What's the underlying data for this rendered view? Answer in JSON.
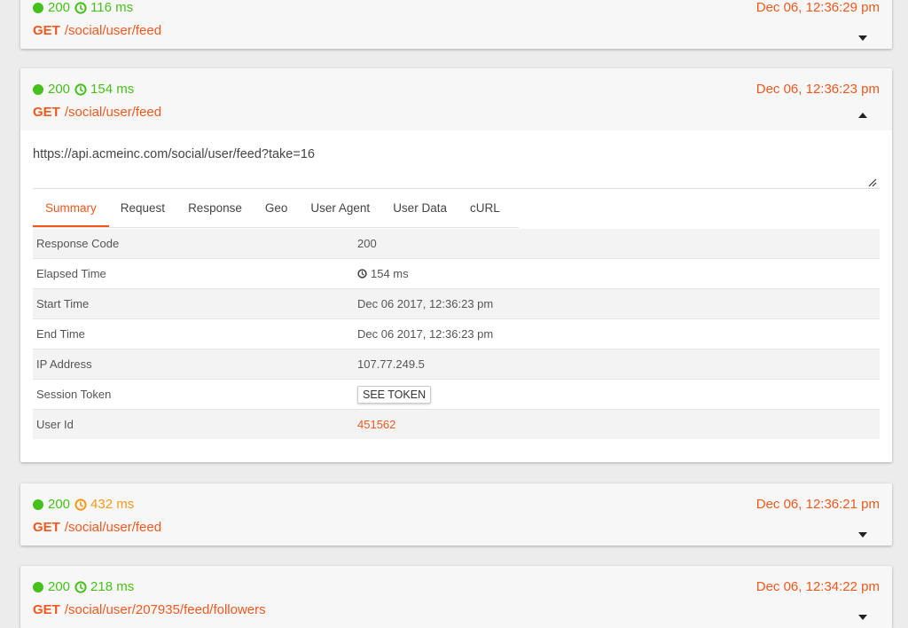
{
  "colors": {
    "success": "#46c01a",
    "warning": "#f39a1a",
    "accent": "#f0581e"
  },
  "requests": [
    {
      "status_code": "200",
      "duration": "116 ms",
      "duration_color": "green",
      "timestamp": "Dec 06, 12:36:29 pm",
      "method": "GET",
      "path": "/social/user/feed",
      "expanded": false
    },
    {
      "status_code": "200",
      "duration": "154 ms",
      "duration_color": "green",
      "timestamp": "Dec 06, 12:36:23 pm",
      "method": "GET",
      "path": "/social/user/feed",
      "expanded": true
    },
    {
      "status_code": "200",
      "duration": "432 ms",
      "duration_color": "orange",
      "timestamp": "Dec 06, 12:36:21 pm",
      "method": "GET",
      "path": "/social/user/feed",
      "expanded": false
    },
    {
      "status_code": "200",
      "duration": "218 ms",
      "duration_color": "green",
      "timestamp": "Dec 06, 12:34:22 pm",
      "method": "GET",
      "path": "/social/user/207935/feed/followers",
      "expanded": false
    }
  ],
  "detail": {
    "url": "https://api.acmeinc.com/social/user/feed?take=16",
    "tabs": [
      "Summary",
      "Request",
      "Response",
      "Geo",
      "User Agent",
      "User Data",
      "cURL"
    ],
    "active_tab": "Summary",
    "summary": {
      "response_code_label": "Response Code",
      "response_code": "200",
      "elapsed_label": "Elapsed Time",
      "elapsed": "154 ms",
      "start_label": "Start Time",
      "start": "Dec 06 2017, 12:36:23 pm",
      "end_label": "End Time",
      "end": "Dec 06 2017, 12:36:23 pm",
      "ip_label": "IP Address",
      "ip": "107.77.249.5",
      "token_label": "Session Token",
      "token_button": "SEE TOKEN",
      "user_label": "User Id",
      "user_id": "451562"
    }
  }
}
